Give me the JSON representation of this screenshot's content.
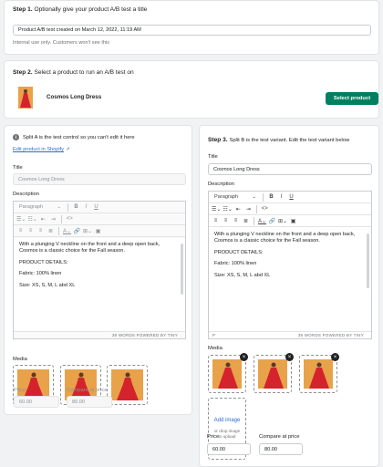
{
  "step1": {
    "step_label": "Step 1.",
    "instruction": "Optionally give your product A/B test a title",
    "title_value": "Product A/B test created on March 12, 2022, 11:19 AM",
    "help_text": "Internal use only. Customers won't see this"
  },
  "step2": {
    "step_label": "Step 2.",
    "instruction": "Select a product to run an A/B test on",
    "product_name": "Cosmos Long Dress",
    "select_button": "Select product",
    "accent": "#008060"
  },
  "split_a": {
    "intro": "Split A is the test control so you can't edit it here",
    "edit_link": "Edit product in Shopify",
    "title_label": "Title",
    "title_value": "Cosmos Long Dress",
    "description_label": "Description",
    "paragraph_select": "Paragraph",
    "body": [
      "With a plunging V neckline on the front and a deep open back, Cosmos is a classic choice for the Fall season.",
      "PRODUCT DETAILS:",
      "Fabric: 100% linen",
      "Size: XS, S, M, L abd XL"
    ],
    "status": "39 WORDS  POWERED BY TINY",
    "media_label": "Media",
    "price_label": "Price",
    "price_value": "60.00",
    "compare_label": "Compare at price",
    "compare_value": "80.00"
  },
  "split_b": {
    "step_label": "Step 3.",
    "intro": "Split B is the test variant. Edit the test variant below",
    "title_label": "Title",
    "title_value": "Cosmos Long Dress",
    "description_label": "Description",
    "paragraph_select": "Paragraph",
    "body": [
      "With a plunging V neckline on the front and a deep open back, Cosmos is a classic choice for the Fall season.",
      "PRODUCT DETAILS:",
      "Fabric: 100% linen",
      "Size: XS, S, M, L abd XL"
    ],
    "status_p": "P",
    "status": "39 WORDS  POWERED BY TINY",
    "media_label": "Media",
    "add_image": "Add image",
    "drop_text": "or drop image to upload",
    "price_label": "Price",
    "price_value": "60.00",
    "compare_label": "Compare at price",
    "compare_value": "80.00"
  },
  "icons": {
    "info": "i",
    "external": "↗",
    "bold": "B",
    "italic": "I",
    "underline": "U",
    "code": "<>",
    "close": "×"
  }
}
